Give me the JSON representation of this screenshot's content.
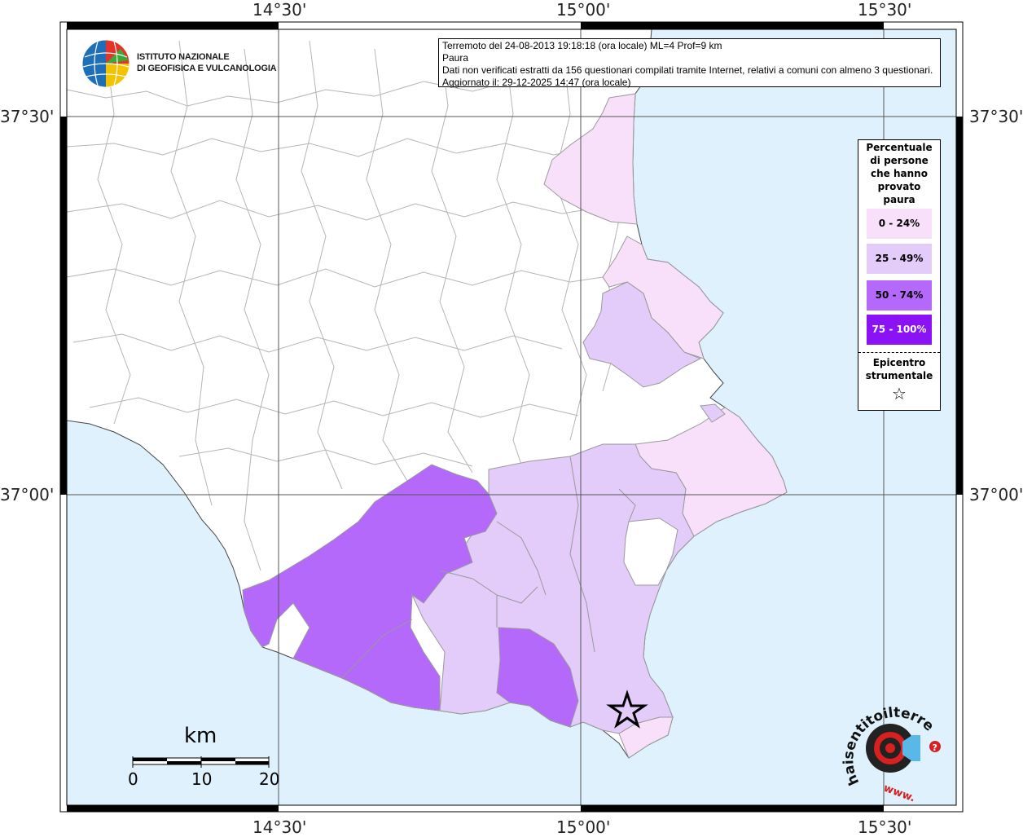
{
  "header": {
    "line1": "Terremoto del 24-08-2013 19:18:18 (ora locale) ML=4 Prof=9 km",
    "line2": "Paura",
    "line3": "Dati non verificati estratti da 156 questionari compilati tramite Internet, relativi a comuni con almeno 3 questionari.",
    "line4": "Aggiornato il: 29-12-2025 14:47 (ora locale)"
  },
  "logo": {
    "line1": "ISTITUTO NAZIONALE",
    "line2": "DI GEOFISICA E VULCANOLOGIA"
  },
  "axes": {
    "top_labels": [
      "14°30'",
      "15°00'",
      "15°30'"
    ],
    "bottom_labels": [
      "14°30'",
      "15°00'",
      "15°30'"
    ],
    "left_labels": [
      "37°30'",
      "37°00'"
    ],
    "right_labels": [
      "37°30'",
      "37°00'"
    ]
  },
  "legend": {
    "title_lines": [
      "Percentuale",
      "di persone",
      "che hanno",
      "provato",
      "paura"
    ],
    "classes": [
      {
        "label": "0 - 24%",
        "color": "#f8e0fa",
        "text_color": "#000000"
      },
      {
        "label": "25 - 49%",
        "color": "#e3cbfa",
        "text_color": "#000000"
      },
      {
        "label": "50 - 74%",
        "color": "#b469fb",
        "text_color": "#000000"
      },
      {
        "label": "75 - 100%",
        "color": "#8a12f5",
        "text_color": "#ffffff"
      }
    ],
    "epicenter_lines": [
      "Epicentro",
      "strumentale"
    ],
    "epicenter_symbol": "☆"
  },
  "scale_bar": {
    "unit": "km",
    "labels": [
      "0",
      "10",
      "20"
    ]
  },
  "colors": {
    "sea": "#dff1fc",
    "land": "#ffffff",
    "boundary": "#b5b5b5",
    "grid": "#555555"
  },
  "brand": {
    "text": "haisentitoilterremoto.it",
    "prefix": "www.",
    "icons": [
      "target-logo-icon",
      "speaker-icon",
      "question-icon"
    ]
  }
}
